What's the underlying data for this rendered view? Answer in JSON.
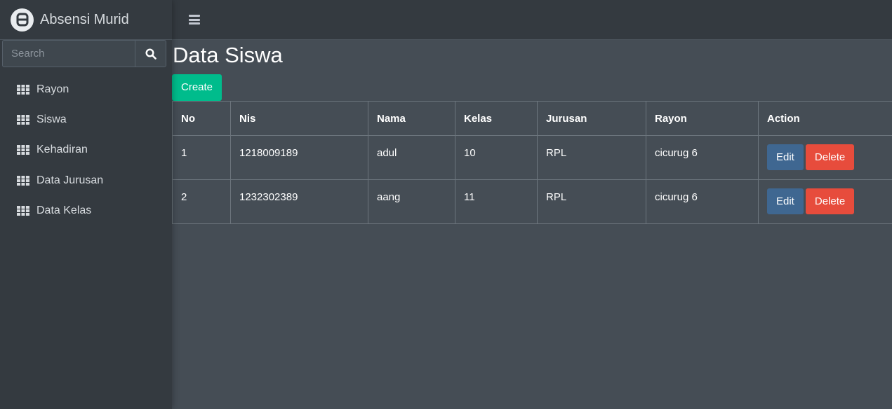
{
  "brand": {
    "name": "Absensi Murid"
  },
  "search": {
    "placeholder": "Search"
  },
  "sidebar": {
    "items": [
      {
        "label": "Rayon",
        "icon": "table-grid-icon"
      },
      {
        "label": "Siswa",
        "icon": "table-grid-icon"
      },
      {
        "label": "Kehadiran",
        "icon": "table-grid-icon"
      },
      {
        "label": "Data Jurusan",
        "icon": "table-grid-icon"
      },
      {
        "label": "Data Kelas",
        "icon": "table-grid-icon"
      }
    ]
  },
  "main": {
    "title": "Data Siswa",
    "create_label": "Create",
    "table": {
      "headers": [
        "No",
        "Nis",
        "Nama",
        "Kelas",
        "Jurusan",
        "Rayon",
        "Action"
      ],
      "rows": [
        [
          "1",
          "1218009189",
          "adul",
          "10",
          "RPL",
          "cicurug 6"
        ],
        [
          "2",
          "1232302389",
          "aang",
          "11",
          "RPL",
          "cicurug 6"
        ]
      ],
      "edit_label": "Edit",
      "delete_label": "Delete"
    }
  },
  "colors": {
    "background": "#454d55",
    "sidebar": "#343a40",
    "create": "#00bc8c",
    "edit": "#3f6791",
    "delete": "#e74c3c"
  }
}
